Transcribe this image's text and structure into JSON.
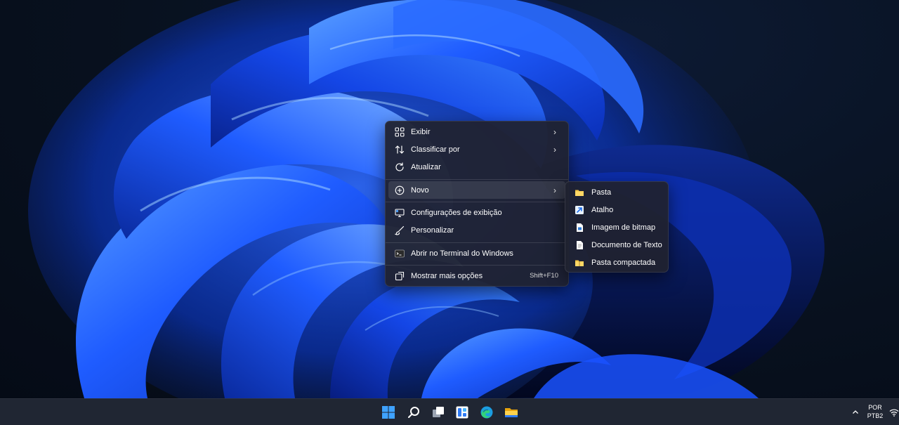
{
  "context_menu": {
    "items": [
      {
        "label": "Exibir",
        "icon": "grid-view-icon",
        "has_submenu": true
      },
      {
        "label": "Classificar por",
        "icon": "sort-arrows-icon",
        "has_submenu": true
      },
      {
        "label": "Atualizar",
        "icon": "refresh-icon",
        "has_submenu": false
      },
      {
        "label": "Novo",
        "icon": "new-plus-icon",
        "has_submenu": true,
        "highlighted": true
      },
      {
        "label": "Configurações de exibição",
        "icon": "display-settings-icon",
        "has_submenu": false
      },
      {
        "label": "Personalizar",
        "icon": "brush-icon",
        "has_submenu": false
      },
      {
        "label": "Abrir no Terminal do Windows",
        "icon": "terminal-icon",
        "has_submenu": false
      },
      {
        "label": "Mostrar mais opções",
        "icon": "more-options-icon",
        "shortcut": "Shift+F10"
      }
    ]
  },
  "submenu_novo": {
    "items": [
      {
        "label": "Pasta",
        "icon": "folder-icon"
      },
      {
        "label": "Atalho",
        "icon": "shortcut-icon"
      },
      {
        "label": "Imagem de bitmap",
        "icon": "bitmap-file-icon"
      },
      {
        "label": "Documento de Texto",
        "icon": "text-document-icon"
      },
      {
        "label": "Pasta compactada",
        "icon": "zip-folder-icon"
      }
    ]
  },
  "taskbar": {
    "apps": [
      "windows-start-icon",
      "search-icon",
      "task-view-icon",
      "widgets-icon",
      "edge-browser-icon",
      "file-explorer-icon"
    ],
    "tray": {
      "lang_line1": "POR",
      "lang_line2": "PTB2"
    }
  },
  "colors": {
    "accent": "#3b78ff",
    "menu_bg": "#202230",
    "taskbar_bg": "#202633",
    "folder": "#f5c542"
  }
}
